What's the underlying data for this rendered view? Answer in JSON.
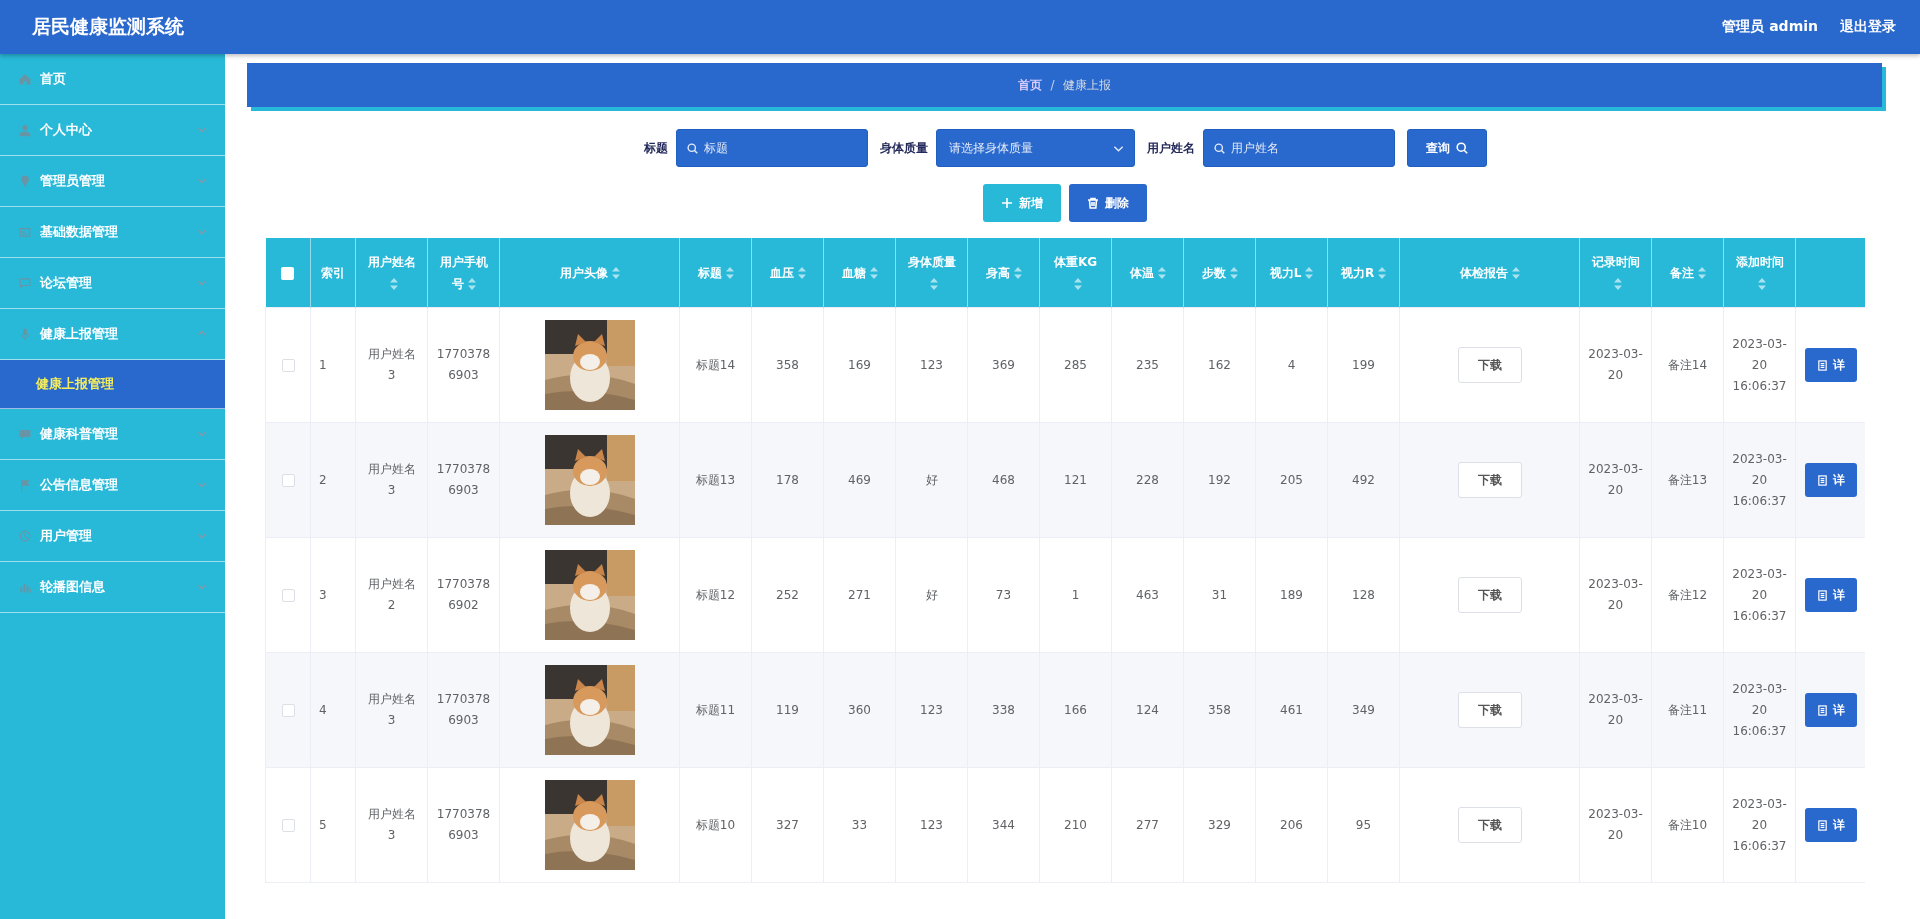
{
  "app": {
    "title": "居民健康监测系统",
    "user": "管理员 admin",
    "logout": "退出登录"
  },
  "sidebar": {
    "items": [
      {
        "label": "首页",
        "kind": "link"
      },
      {
        "label": "个人中心",
        "kind": "menu",
        "expanded": false
      },
      {
        "label": "管理员管理",
        "kind": "menu",
        "expanded": false
      },
      {
        "label": "基础数据管理",
        "kind": "menu",
        "expanded": false
      },
      {
        "label": "论坛管理",
        "kind": "menu",
        "expanded": false
      },
      {
        "label": "健康上报管理",
        "kind": "menu",
        "expanded": true,
        "children": [
          {
            "label": "健康上报管理",
            "selected": true
          }
        ]
      },
      {
        "label": "健康科普管理",
        "kind": "menu",
        "expanded": false
      },
      {
        "label": "公告信息管理",
        "kind": "menu",
        "expanded": false
      },
      {
        "label": "用户管理",
        "kind": "menu",
        "expanded": false
      },
      {
        "label": "轮播图信息",
        "kind": "menu",
        "expanded": false
      }
    ]
  },
  "breadcrumb": {
    "items": [
      "首页",
      "健康上报"
    ],
    "separator": "/"
  },
  "filters": [
    {
      "kind": "text",
      "label": "标题",
      "placeholder": "标题"
    },
    {
      "kind": "select",
      "label": "身体质量",
      "placeholder": "请选择身体质量"
    },
    {
      "kind": "text",
      "label": "用户姓名",
      "placeholder": "用户姓名"
    }
  ],
  "search_button": "查询",
  "actions": [
    {
      "kind": "add",
      "label": "新增"
    },
    {
      "kind": "delete",
      "label": "删除"
    }
  ],
  "table": {
    "select_all": {
      "checked": false
    },
    "columns": [
      {
        "label": "索引",
        "sortable": false
      },
      {
        "label": "用户姓名",
        "sortable": true
      },
      {
        "label": "用户手机号",
        "sortable": true
      },
      {
        "label": "用户头像",
        "sortable": true
      },
      {
        "label": "标题",
        "sortable": true
      },
      {
        "label": "血压",
        "sortable": true
      },
      {
        "label": "血糖",
        "sortable": true
      },
      {
        "label": "身体质量",
        "sortable": true
      },
      {
        "label": "身高",
        "sortable": true
      },
      {
        "label": "体重KG",
        "sortable": true
      },
      {
        "label": "体温",
        "sortable": true
      },
      {
        "label": "步数",
        "sortable": true
      },
      {
        "label": "视力L",
        "sortable": true
      },
      {
        "label": "视力R",
        "sortable": true
      },
      {
        "label": "体检报告",
        "sortable": true
      },
      {
        "label": "记录时间",
        "sortable": true
      },
      {
        "label": "备注",
        "sortable": true
      },
      {
        "label": "添加时间",
        "sortable": true
      }
    ],
    "rows": [
      {
        "checked": false,
        "cells": [
          "1",
          "用户姓名3",
          "17703786903",
          {
            "kind": "picture"
          },
          "标题14",
          "358",
          "169",
          "123",
          "369",
          "285",
          "235",
          "162",
          "4",
          "199",
          {
            "kind": "button",
            "text": "下载"
          },
          "2023-03-20",
          "备注14",
          "2023-03-20 16:06:37",
          {
            "kind": "action",
            "text": "详"
          }
        ]
      },
      {
        "checked": false,
        "cells": [
          "2",
          "用户姓名3",
          "17703786903",
          {
            "kind": "picture"
          },
          "标题13",
          "178",
          "469",
          "好",
          "468",
          "121",
          "228",
          "192",
          "205",
          "492",
          {
            "kind": "button",
            "text": "下载"
          },
          "2023-03-20",
          "备注13",
          "2023-03-20 16:06:37",
          {
            "kind": "action",
            "text": "详"
          }
        ]
      },
      {
        "checked": false,
        "cells": [
          "3",
          "用户姓名2",
          "17703786902",
          {
            "kind": "picture"
          },
          "标题12",
          "252",
          "271",
          "好",
          "73",
          "1",
          "463",
          "31",
          "189",
          "128",
          {
            "kind": "button",
            "text": "下载"
          },
          "2023-03-20",
          "备注12",
          "2023-03-20 16:06:37",
          {
            "kind": "action",
            "text": "详"
          }
        ]
      },
      {
        "checked": false,
        "cells": [
          "4",
          "用户姓名3",
          "17703786903",
          {
            "kind": "picture"
          },
          "标题11",
          "119",
          "360",
          "123",
          "338",
          "166",
          "124",
          "358",
          "461",
          "349",
          {
            "kind": "button",
            "text": "下载"
          },
          "2023-03-20",
          "备注11",
          "2023-03-20 16:06:37",
          {
            "kind": "action",
            "text": "详"
          }
        ]
      },
      {
        "checked": false,
        "cells": [
          "5",
          "用户姓名3",
          "17703786903",
          {
            "kind": "picture"
          },
          "标题10",
          "327",
          "33",
          "123",
          "344",
          "210",
          "277",
          "329",
          "206",
          "95",
          {
            "kind": "button",
            "text": "下载"
          },
          "2023-03-20",
          "备注10",
          "2023-03-20 16:06:37",
          {
            "kind": "action",
            "text": "详"
          }
        ]
      }
    ]
  }
}
